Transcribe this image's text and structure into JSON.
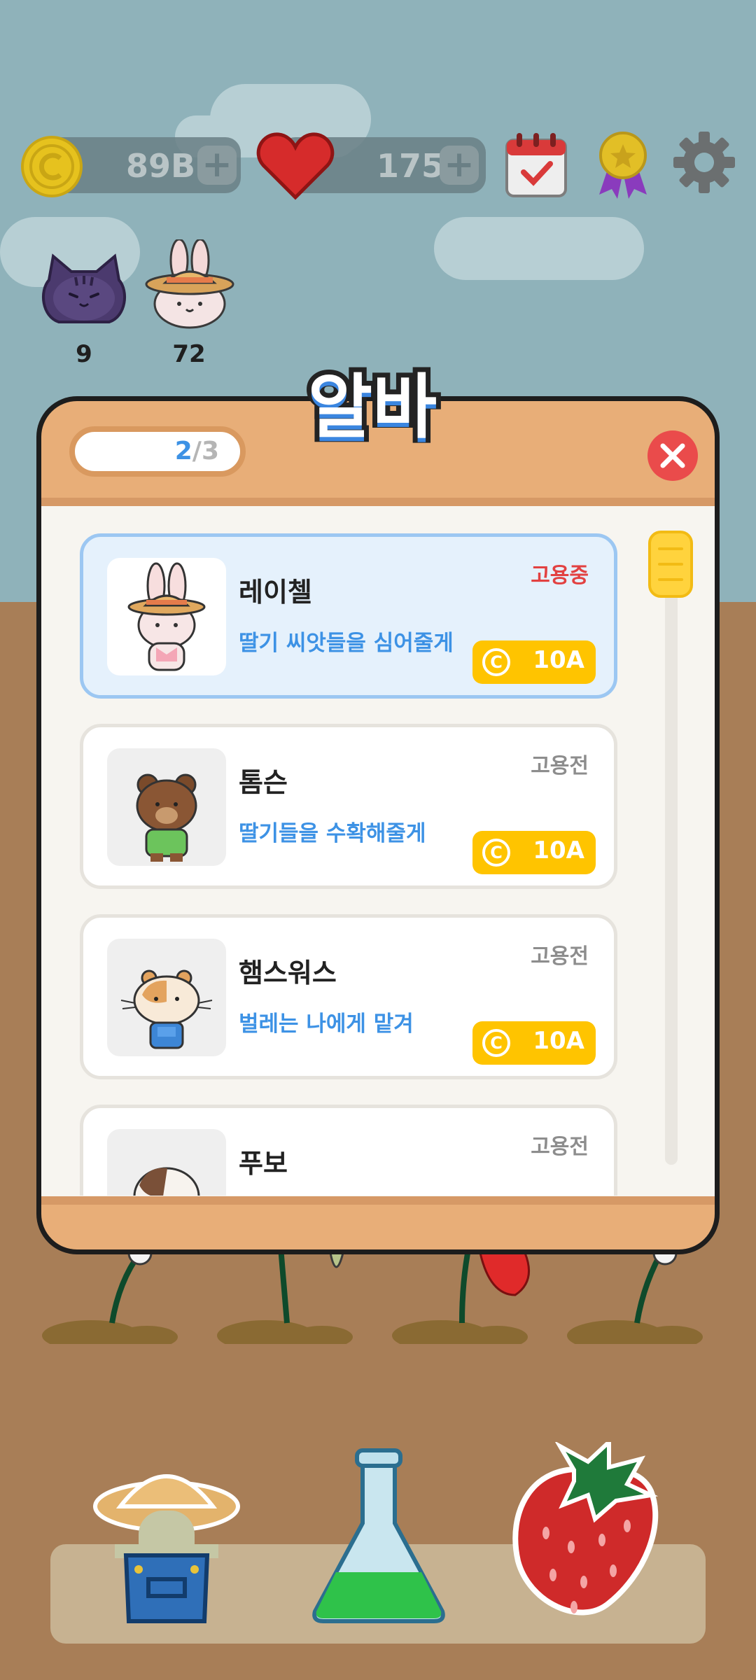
{
  "hud": {
    "coins": "89B",
    "hearts": "175",
    "plus_label": "+"
  },
  "workers_row": [
    {
      "count": "9"
    },
    {
      "count": "72"
    }
  ],
  "modal": {
    "title": "알바",
    "pager": {
      "current": "2",
      "separator": "/",
      "total": "3"
    },
    "cards": [
      {
        "name": "레이첼",
        "desc": "딸기 씨앗들을 심어줄게",
        "status": "고용중",
        "cost": "10A",
        "active": true
      },
      {
        "name": "톰슨",
        "desc": "딸기들을 수확해줄게",
        "status": "고용전",
        "cost": "10A",
        "active": false
      },
      {
        "name": "햄스워스",
        "desc": "벌레는 나에게 맡겨",
        "status": "고용전",
        "cost": "10A",
        "active": false
      },
      {
        "name": "푸보",
        "desc": "",
        "status": "고용전",
        "cost": "",
        "active": false
      }
    ],
    "coin_symbol": "C"
  },
  "colors": {
    "sky": "#8fb2ba",
    "ground": "#a87e57",
    "accent_blue": "#3d92e5",
    "hired_red": "#e24141",
    "cost_yellow": "#ffc400",
    "close_red": "#ea4b4b"
  },
  "icons": {
    "coin": "coin-icon",
    "heart": "heart-icon",
    "calendar": "calendar-check-icon",
    "medal": "medal-icon",
    "settings": "gear-icon",
    "close": "close-icon",
    "farmer": "farmer-icon",
    "flask": "flask-icon",
    "strawberry": "strawberry-icon"
  }
}
